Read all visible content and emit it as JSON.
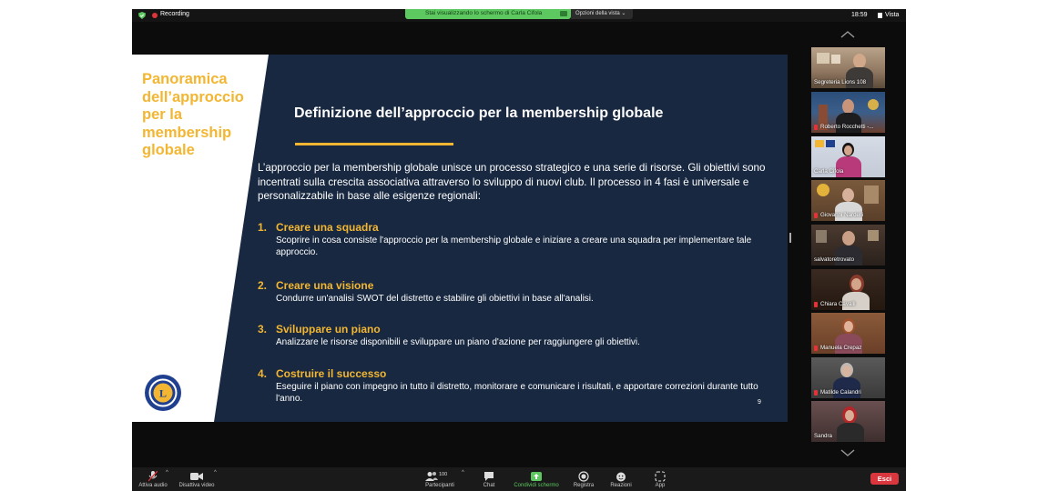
{
  "top_bar": {
    "recording_label": "Recording",
    "share_banner": "Stai visualizzando lo schermo di Carla Cifola",
    "view_options": "Opzioni della vista ⌄",
    "clock": "18:59",
    "view_label": "Vista"
  },
  "slide": {
    "side_title": "Panoramica dell’approccio per la membership globale",
    "title": "Definizione dell’approccio per la membership globale",
    "intro": "L’approccio per la membership globale unisce un processo strategico e una serie di risorse. Gli obiettivi sono incentrati sulla crescita associativa attraverso lo sviluppo di nuovi club. Il processo in 4 fasi è universale e personalizzabile in base alle esigenze regionali:",
    "steps": [
      {
        "number": "1.",
        "title": "Creare una squadra",
        "description": "Scoprire in cosa consiste l'approccio per la membership globale e iniziare a creare una squadra per implementare tale approccio."
      },
      {
        "number": "2.",
        "title": "Creare una visione",
        "description": "Condurre un'analisi SWOT del distretto e stabilire gli obiettivi in base all'analisi."
      },
      {
        "number": "3.",
        "title": "Sviluppare un piano",
        "description": "Analizzare le risorse disponibili e sviluppare un piano d'azione per raggiungere gli obiettivi."
      },
      {
        "number": "4.",
        "title": "Costruire il successo",
        "description": "Eseguire il piano con impegno in tutto il distretto, monitorare e comunicare i risultati, e apportare correzioni durante tutto l'anno."
      }
    ],
    "page_number": "9",
    "logo_text": "LIONS INTERNATIONAL"
  },
  "participants": [
    {
      "name": "Segreteria Lions 108",
      "muted": false
    },
    {
      "name": "Roberto Rocchetti -...",
      "muted": true
    },
    {
      "name": "Carla Cifola",
      "muted": false
    },
    {
      "name": "Giovanni Nardelli",
      "muted": true
    },
    {
      "name": "salvatoretrovato",
      "muted": false
    },
    {
      "name": "Chiara Cavalli",
      "muted": true
    },
    {
      "name": "Manuela Crepaz",
      "muted": true
    },
    {
      "name": "Matilde Calandri",
      "muted": true
    },
    {
      "name": "Sandra",
      "muted": false
    }
  ],
  "toolbar": {
    "audio_label": "Attiva audio",
    "video_label": "Disattiva video",
    "participants_label": "Partecipanti",
    "participants_count": "100",
    "chat_label": "Chat",
    "share_label": "Condividi schermo",
    "record_label": "Registra",
    "reactions_label": "Reazioni",
    "apps_label": "App",
    "exit_label": "Esci"
  },
  "colors": {
    "slide_bg": "#182840",
    "accent_gold": "#f2b632",
    "share_green": "#5cc85f",
    "exit_red": "#d9363e"
  }
}
